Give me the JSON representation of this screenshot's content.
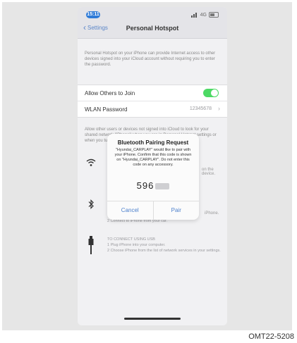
{
  "status_bar": {
    "time": "15:11",
    "carrier": "4G"
  },
  "navbar": {
    "back_label": "Settings",
    "title": "Personal Hotspot"
  },
  "description": "Personal Hotspot on your iPhone can provide Internet access to other devices signed into your iCloud account without requiring you to enter the password.",
  "settings": {
    "allow_others_label": "Allow Others to Join",
    "allow_others_on": true,
    "wlan_label": "WLAN Password",
    "wlan_value": "12345678"
  },
  "below_text": "Allow other users or devices not signed into iCloud to look for your shared network \"iPhone\" when you are in Personal Hotspot settings or when you turn it on in Control Centre.",
  "side_snippets": {
    "wifi_side": "on the device.",
    "bt_side": "iPhone."
  },
  "bt_instructions": "2 Connect to iPhone from your car.",
  "usb_instructions": [
    "TO CONNECT USING USB",
    "1 Plug iPhone into your computer.",
    "2 Choose iPhone from the list of network services in your settings."
  ],
  "alert": {
    "title": "Bluetooth Pairing Request",
    "message": "\"Hyundai_CARPLAY\" would like to pair with your iPhone. Confirm that this code is shown on \"Hyundai_CARPLAY\". Do not enter this code on any accessory.",
    "code_visible": "596",
    "cancel_label": "Cancel",
    "pair_label": "Pair"
  },
  "figure_code": "OMT22-5208",
  "colors": {
    "toggle": "#4cd964",
    "accent": "#4b7fcc",
    "time_pill": "#2f7bd8"
  }
}
